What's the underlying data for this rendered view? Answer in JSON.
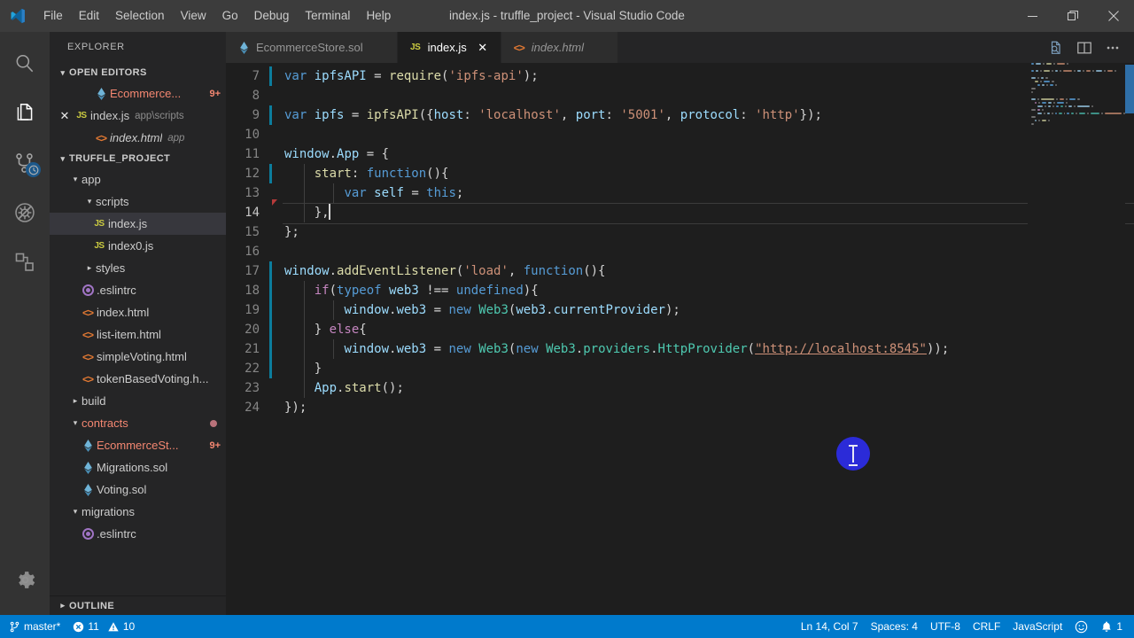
{
  "window": {
    "title": "index.js - truffle_project - Visual Studio Code",
    "logo_icon": "vscode-logo-icon",
    "minimize_icon": "minimize-icon",
    "restore_icon": "restore-icon",
    "close_icon": "close-icon"
  },
  "menubar": {
    "items": [
      {
        "label": "File"
      },
      {
        "label": "Edit"
      },
      {
        "label": "Selection"
      },
      {
        "label": "View"
      },
      {
        "label": "Go"
      },
      {
        "label": "Debug"
      },
      {
        "label": "Terminal"
      },
      {
        "label": "Help"
      }
    ]
  },
  "activitybar": {
    "items": [
      {
        "name": "search-icon",
        "title": "Search",
        "active": false
      },
      {
        "name": "explorer-files-icon",
        "title": "Explorer",
        "active": true
      },
      {
        "name": "source-control-icon",
        "title": "Source Control",
        "active": false,
        "badge": "clock"
      },
      {
        "name": "debug-disabled-icon",
        "title": "Debug",
        "active": false
      },
      {
        "name": "extensions-icon",
        "title": "Extensions",
        "active": false
      }
    ],
    "bottom": [
      {
        "name": "gear-icon",
        "title": "Manage"
      }
    ]
  },
  "sidebar": {
    "title": "EXPLORER",
    "open_editors": {
      "label": "OPEN EDITORS",
      "expanded": true,
      "items": [
        {
          "label": "Ecommerce...",
          "icon": "solidity-icon",
          "badge": "9+",
          "error": true,
          "indent": 3,
          "close": false
        },
        {
          "label": "index.js",
          "icon": "js-icon",
          "description": "app\\scripts",
          "indent": 1,
          "close": true,
          "selected": false
        },
        {
          "label": "index.html",
          "icon": "html-icon",
          "description": "app",
          "italic": true,
          "indent": 3,
          "close": false
        }
      ]
    },
    "project": {
      "label": "TRUFFLE_PROJECT",
      "expanded": true,
      "items": [
        {
          "label": "app",
          "type": "folder",
          "state": "open",
          "indent": 1
        },
        {
          "label": "scripts",
          "type": "folder",
          "state": "open",
          "indent": 2
        },
        {
          "label": "index.js",
          "type": "js",
          "indent": 3,
          "selected": true
        },
        {
          "label": "index0.js",
          "type": "js",
          "indent": 3
        },
        {
          "label": "styles",
          "type": "folder",
          "state": "closed",
          "indent": 2
        },
        {
          "label": ".eslintrc",
          "type": "eslint",
          "indent": 2
        },
        {
          "label": "index.html",
          "type": "html",
          "indent": 2
        },
        {
          "label": "list-item.html",
          "type": "html",
          "indent": 2
        },
        {
          "label": "simpleVoting.html",
          "type": "html",
          "indent": 2
        },
        {
          "label": "tokenBasedVoting.h...",
          "type": "html",
          "indent": 2
        },
        {
          "label": "build",
          "type": "folder",
          "state": "closed",
          "indent": 1
        },
        {
          "label": "contracts",
          "type": "folder",
          "state": "open",
          "indent": 1,
          "error": true,
          "dot": true
        },
        {
          "label": "EcommerceSt...",
          "type": "sol",
          "indent": 2,
          "error": true,
          "badge": "9+"
        },
        {
          "label": "Migrations.sol",
          "type": "sol",
          "indent": 2
        },
        {
          "label": "Voting.sol",
          "type": "sol",
          "indent": 2
        },
        {
          "label": "migrations",
          "type": "folder",
          "state": "open",
          "indent": 1
        },
        {
          "label": ".eslintrc",
          "type": "eslint",
          "indent": 2
        }
      ]
    },
    "outline": {
      "label": "OUTLINE",
      "expanded": false
    }
  },
  "tabs": {
    "items": [
      {
        "label": "EcommerceStore.sol",
        "icon": "solidity-icon",
        "active": false,
        "preview": false
      },
      {
        "label": "index.js",
        "icon": "js-icon",
        "active": true,
        "preview": false
      },
      {
        "label": "index.html",
        "icon": "html-icon",
        "active": false,
        "preview": true
      }
    ],
    "close_label": "✕",
    "actions": [
      {
        "name": "open-changes-icon",
        "title": "Open Changes"
      },
      {
        "name": "split-editor-icon",
        "title": "Split Editor"
      },
      {
        "name": "more-actions-icon",
        "title": "More Actions..."
      }
    ]
  },
  "editor": {
    "first_line_number": 7,
    "current_line": 14,
    "lines": [
      {
        "n": 7,
        "modified": true,
        "tokens": [
          {
            "t": "var ",
            "c": "t-key"
          },
          {
            "t": "ipfsAPI ",
            "c": "t-var"
          },
          {
            "t": "= ",
            "c": "t-plain"
          },
          {
            "t": "require",
            "c": "t-fn"
          },
          {
            "t": "(",
            "c": "t-plain"
          },
          {
            "t": "'ipfs-api'",
            "c": "t-str"
          },
          {
            "t": ");",
            "c": "t-plain"
          }
        ]
      },
      {
        "n": 8,
        "modified": false,
        "tokens": []
      },
      {
        "n": 9,
        "modified": true,
        "tokens": [
          {
            "t": "var ",
            "c": "t-key"
          },
          {
            "t": "ipfs ",
            "c": "t-var"
          },
          {
            "t": "= ",
            "c": "t-plain"
          },
          {
            "t": "ipfsAPI",
            "c": "t-fn"
          },
          {
            "t": "({",
            "c": "t-plain"
          },
          {
            "t": "host",
            "c": "t-var"
          },
          {
            "t": ": ",
            "c": "t-plain"
          },
          {
            "t": "'localhost'",
            "c": "t-str"
          },
          {
            "t": ", ",
            "c": "t-plain"
          },
          {
            "t": "port",
            "c": "t-var"
          },
          {
            "t": ": ",
            "c": "t-plain"
          },
          {
            "t": "'5001'",
            "c": "t-str"
          },
          {
            "t": ", ",
            "c": "t-plain"
          },
          {
            "t": "protocol",
            "c": "t-var"
          },
          {
            "t": ": ",
            "c": "t-plain"
          },
          {
            "t": "'http'",
            "c": "t-str"
          },
          {
            "t": "});",
            "c": "t-plain"
          }
        ]
      },
      {
        "n": 10,
        "modified": false,
        "tokens": []
      },
      {
        "n": 11,
        "modified": false,
        "tokens": [
          {
            "t": "window",
            "c": "t-var"
          },
          {
            "t": ".",
            "c": "t-plain"
          },
          {
            "t": "App ",
            "c": "t-var"
          },
          {
            "t": "= {",
            "c": "t-plain"
          }
        ]
      },
      {
        "n": 12,
        "modified": true,
        "guides": [
          1
        ],
        "tokens": [
          {
            "t": "    ",
            "c": "t-plain"
          },
          {
            "t": "start",
            "c": "t-fn"
          },
          {
            "t": ": ",
            "c": "t-plain"
          },
          {
            "t": "function",
            "c": "t-key"
          },
          {
            "t": "(){",
            "c": "t-plain"
          }
        ]
      },
      {
        "n": 13,
        "modified": false,
        "guides": [
          1,
          2
        ],
        "tokens": [
          {
            "t": "        ",
            "c": "t-plain"
          },
          {
            "t": "var ",
            "c": "t-key"
          },
          {
            "t": "self ",
            "c": "t-var"
          },
          {
            "t": "= ",
            "c": "t-plain"
          },
          {
            "t": "this",
            "c": "t-key"
          },
          {
            "t": ";",
            "c": "t-plain"
          }
        ]
      },
      {
        "n": 14,
        "modified": false,
        "error_marker": true,
        "guides": [
          1
        ],
        "cursor_after": true,
        "tokens": [
          {
            "t": "    },",
            "c": "t-plain"
          }
        ]
      },
      {
        "n": 15,
        "modified": false,
        "tokens": [
          {
            "t": "};",
            "c": "t-plain"
          }
        ]
      },
      {
        "n": 16,
        "modified": false,
        "tokens": []
      },
      {
        "n": 17,
        "modified": true,
        "tokens": [
          {
            "t": "window",
            "c": "t-var"
          },
          {
            "t": ".",
            "c": "t-plain"
          },
          {
            "t": "addEventListener",
            "c": "t-fn"
          },
          {
            "t": "(",
            "c": "t-plain"
          },
          {
            "t": "'load'",
            "c": "t-str"
          },
          {
            "t": ", ",
            "c": "t-plain"
          },
          {
            "t": "function",
            "c": "t-key"
          },
          {
            "t": "(){",
            "c": "t-plain"
          }
        ]
      },
      {
        "n": 18,
        "modified": true,
        "guides": [
          1
        ],
        "tokens": [
          {
            "t": "    ",
            "c": "t-plain"
          },
          {
            "t": "if",
            "c": "t-ctrl"
          },
          {
            "t": "(",
            "c": "t-plain"
          },
          {
            "t": "typeof ",
            "c": "t-key"
          },
          {
            "t": "web3 ",
            "c": "t-var"
          },
          {
            "t": "!== ",
            "c": "t-plain"
          },
          {
            "t": "undefined",
            "c": "t-key"
          },
          {
            "t": "){",
            "c": "t-plain"
          }
        ]
      },
      {
        "n": 19,
        "modified": true,
        "guides": [
          1,
          2
        ],
        "tokens": [
          {
            "t": "        ",
            "c": "t-plain"
          },
          {
            "t": "window",
            "c": "t-var"
          },
          {
            "t": ".",
            "c": "t-plain"
          },
          {
            "t": "web3 ",
            "c": "t-var"
          },
          {
            "t": "= ",
            "c": "t-plain"
          },
          {
            "t": "new ",
            "c": "t-key"
          },
          {
            "t": "Web3",
            "c": "t-cls"
          },
          {
            "t": "(",
            "c": "t-plain"
          },
          {
            "t": "web3",
            "c": "t-var"
          },
          {
            "t": ".",
            "c": "t-plain"
          },
          {
            "t": "currentProvider",
            "c": "t-var"
          },
          {
            "t": ");",
            "c": "t-plain"
          }
        ]
      },
      {
        "n": 20,
        "modified": true,
        "guides": [
          1
        ],
        "tokens": [
          {
            "t": "    } ",
            "c": "t-plain"
          },
          {
            "t": "else",
            "c": "t-ctrl"
          },
          {
            "t": "{",
            "c": "t-plain"
          }
        ]
      },
      {
        "n": 21,
        "modified": true,
        "guides": [
          1,
          2
        ],
        "tokens": [
          {
            "t": "        ",
            "c": "t-plain"
          },
          {
            "t": "window",
            "c": "t-var"
          },
          {
            "t": ".",
            "c": "t-plain"
          },
          {
            "t": "web3 ",
            "c": "t-var"
          },
          {
            "t": "= ",
            "c": "t-plain"
          },
          {
            "t": "new ",
            "c": "t-key"
          },
          {
            "t": "Web3",
            "c": "t-cls"
          },
          {
            "t": "(",
            "c": "t-plain"
          },
          {
            "t": "new ",
            "c": "t-key"
          },
          {
            "t": "Web3",
            "c": "t-cls"
          },
          {
            "t": ".",
            "c": "t-plain"
          },
          {
            "t": "providers",
            "c": "t-cls"
          },
          {
            "t": ".",
            "c": "t-plain"
          },
          {
            "t": "HttpProvider",
            "c": "t-cls"
          },
          {
            "t": "(",
            "c": "t-plain"
          },
          {
            "t": "\"http://localhost:8545\"",
            "c": "t-link"
          },
          {
            "t": "));",
            "c": "t-plain"
          }
        ]
      },
      {
        "n": 22,
        "modified": true,
        "guides": [
          1
        ],
        "tokens": [
          {
            "t": "    }",
            "c": "t-plain"
          }
        ]
      },
      {
        "n": 23,
        "modified": false,
        "guides": [
          1
        ],
        "tokens": [
          {
            "t": "    ",
            "c": "t-plain"
          },
          {
            "t": "App",
            "c": "t-var"
          },
          {
            "t": ".",
            "c": "t-plain"
          },
          {
            "t": "start",
            "c": "t-fn"
          },
          {
            "t": "();",
            "c": "t-plain"
          }
        ]
      },
      {
        "n": 24,
        "modified": false,
        "tokens": [
          {
            "t": "});",
            "c": "t-plain"
          }
        ]
      }
    ]
  },
  "statusbar": {
    "left": [
      {
        "name": "branch-status",
        "icon": "source-control-icon",
        "label": "master*"
      },
      {
        "name": "problems-status",
        "icon": "error-icon",
        "label": "11",
        "icon2": "warning-icon",
        "label2": "10"
      }
    ],
    "right": [
      {
        "name": "cursor-position-status",
        "label": "Ln 14, Col 7"
      },
      {
        "name": "indentation-status",
        "label": "Spaces: 4"
      },
      {
        "name": "encoding-status",
        "label": "UTF-8"
      },
      {
        "name": "eol-status",
        "label": "CRLF"
      },
      {
        "name": "language-mode-status",
        "label": "JavaScript"
      },
      {
        "name": "feedback-smiley-status",
        "label": "",
        "icon": "smiley-icon"
      },
      {
        "name": "notifications-status",
        "label": "1",
        "icon": "bell-icon"
      }
    ]
  },
  "colors": {
    "titlebar_bg": "#3c3c3c",
    "activitybar_bg": "#333333",
    "sidebar_bg": "#252526",
    "editor_bg": "#1e1e1e",
    "statusbar_bg": "#007acc",
    "accent_badge": "#f48771",
    "git_modified": "#0c7d9d",
    "selection_bg": "#37373d"
  }
}
